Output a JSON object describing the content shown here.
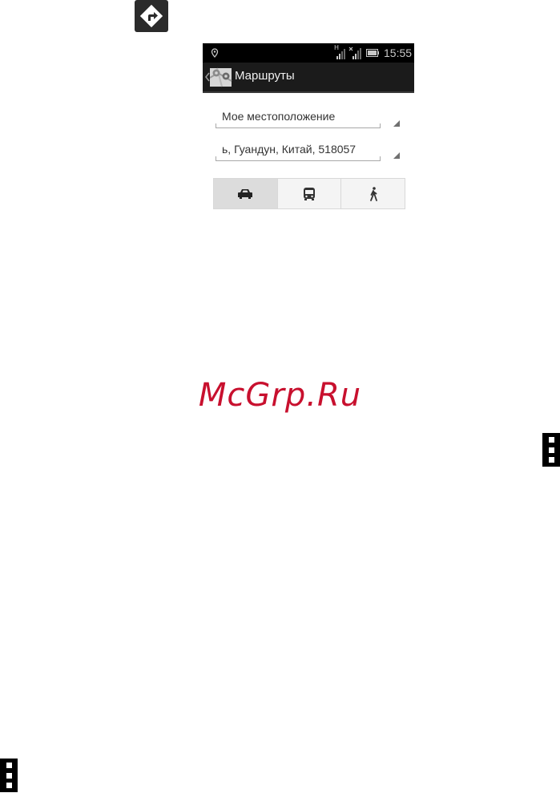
{
  "status_bar": {
    "time": "15:55",
    "icons": [
      "location-pin-icon",
      "signal-h-icon",
      "signal-x-icon",
      "battery-icon"
    ],
    "network_label": "H"
  },
  "action_bar": {
    "title": "Маршруты",
    "icons": [
      "back-chevron-icon",
      "maps-app-icon"
    ]
  },
  "route": {
    "from_value": "Мое местоположение",
    "to_value": "ь, Гуандун, Китай, 518057"
  },
  "travel_modes": [
    {
      "icon": "car-icon",
      "active": true
    },
    {
      "icon": "bus-icon",
      "active": false
    },
    {
      "icon": "walk-icon",
      "active": false
    }
  ],
  "watermark": "McGrp.Ru",
  "page_icons": [
    "directions-icon",
    "overflow-menu-icon"
  ],
  "colors": {
    "watermark": "#c8102e",
    "action_bar": "#1b1b1b",
    "status_bar": "#000000"
  }
}
